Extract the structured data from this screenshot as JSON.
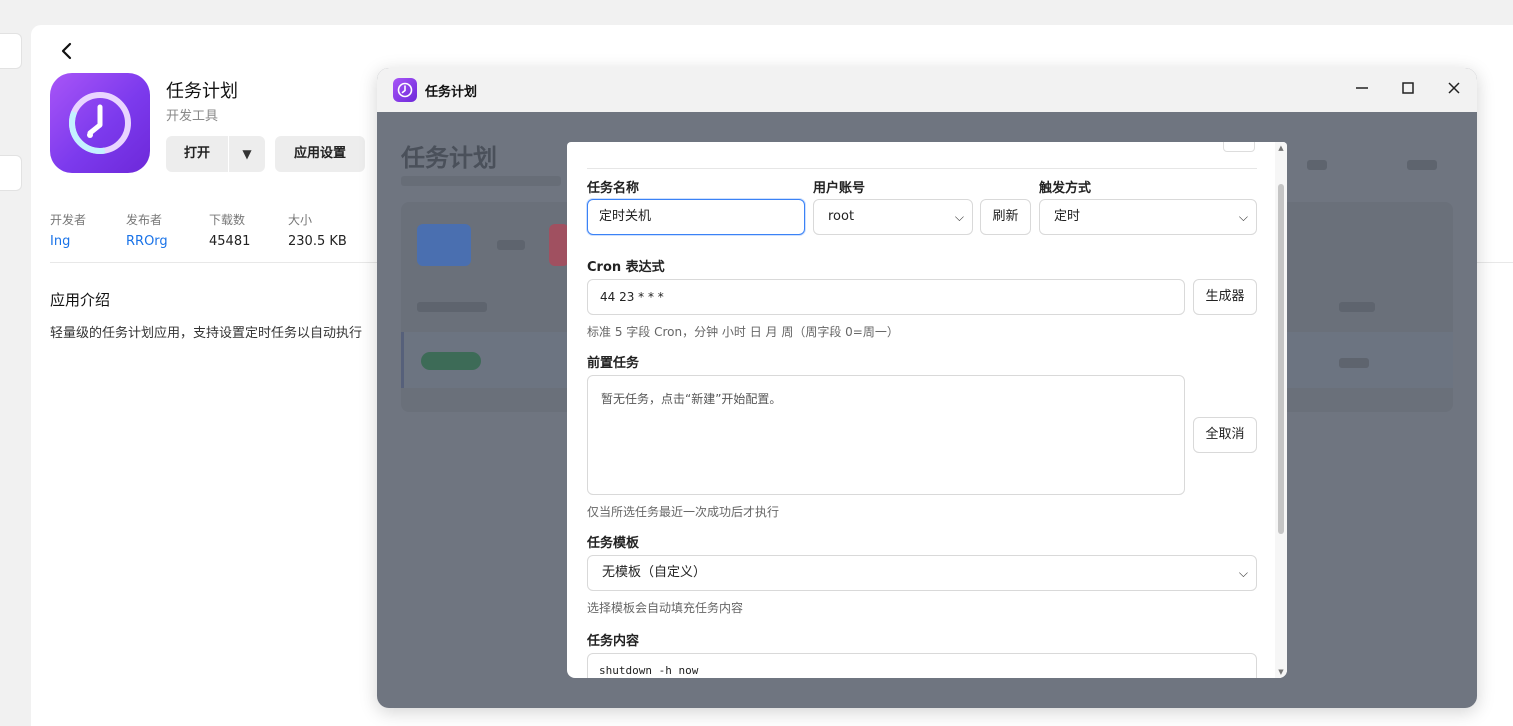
{
  "detail": {
    "app_name": "任务计划",
    "category": "开发工具",
    "open_label": "打开",
    "settings_label": "应用设置",
    "stats": [
      {
        "key": "开发者",
        "value": "Ing"
      },
      {
        "key": "发布者",
        "value": "RROrg"
      },
      {
        "key": "下载数",
        "value": "45481"
      },
      {
        "key": "大小",
        "value": "230.5 KB"
      }
    ],
    "intro_title": "应用介绍",
    "intro_text": "轻量级的任务计划应用，支持设置定时任务以自动执行"
  },
  "window": {
    "title": "任务计划",
    "bg_title": "任务计划"
  },
  "form": {
    "task_name_label": "任务名称",
    "task_name_value": "定时关机",
    "user_label": "用户账号",
    "user_value": "root",
    "refresh_label": "刷新",
    "trigger_label": "触发方式",
    "trigger_value": "定时",
    "cron_label": "Cron 表达式",
    "cron_value": "44 23 * * *",
    "generator_label": "生成器",
    "cron_hint": "标准 5 字段 Cron，分钟 小时 日 月 周（周字段 0=周一）",
    "pre_label": "前置任务",
    "pre_empty": "暂无任务，点击“新建”开始配置。",
    "deselect_label": "全取消",
    "pre_hint": "仅当所选任务最近一次成功后才执行",
    "template_label": "任务模板",
    "template_value": "无模板（自定义）",
    "template_hint": "选择模板会自动填充任务内容",
    "content_label": "任务内容",
    "content_value": "shutdown -h now"
  },
  "colors": {
    "accent": "#3b82f6",
    "icon_gradient_start": "#a855f7",
    "icon_gradient_end": "#6d28d9",
    "link": "#1a73e8",
    "overlay": "#6f7580"
  },
  "icons": {
    "back": "chevron-left-icon",
    "app": "clock-icon",
    "caret": "caret-down-icon",
    "minimize": "minimize-icon",
    "maximize": "maximize-icon",
    "close": "close-icon",
    "select": "chevron-down-icon"
  }
}
